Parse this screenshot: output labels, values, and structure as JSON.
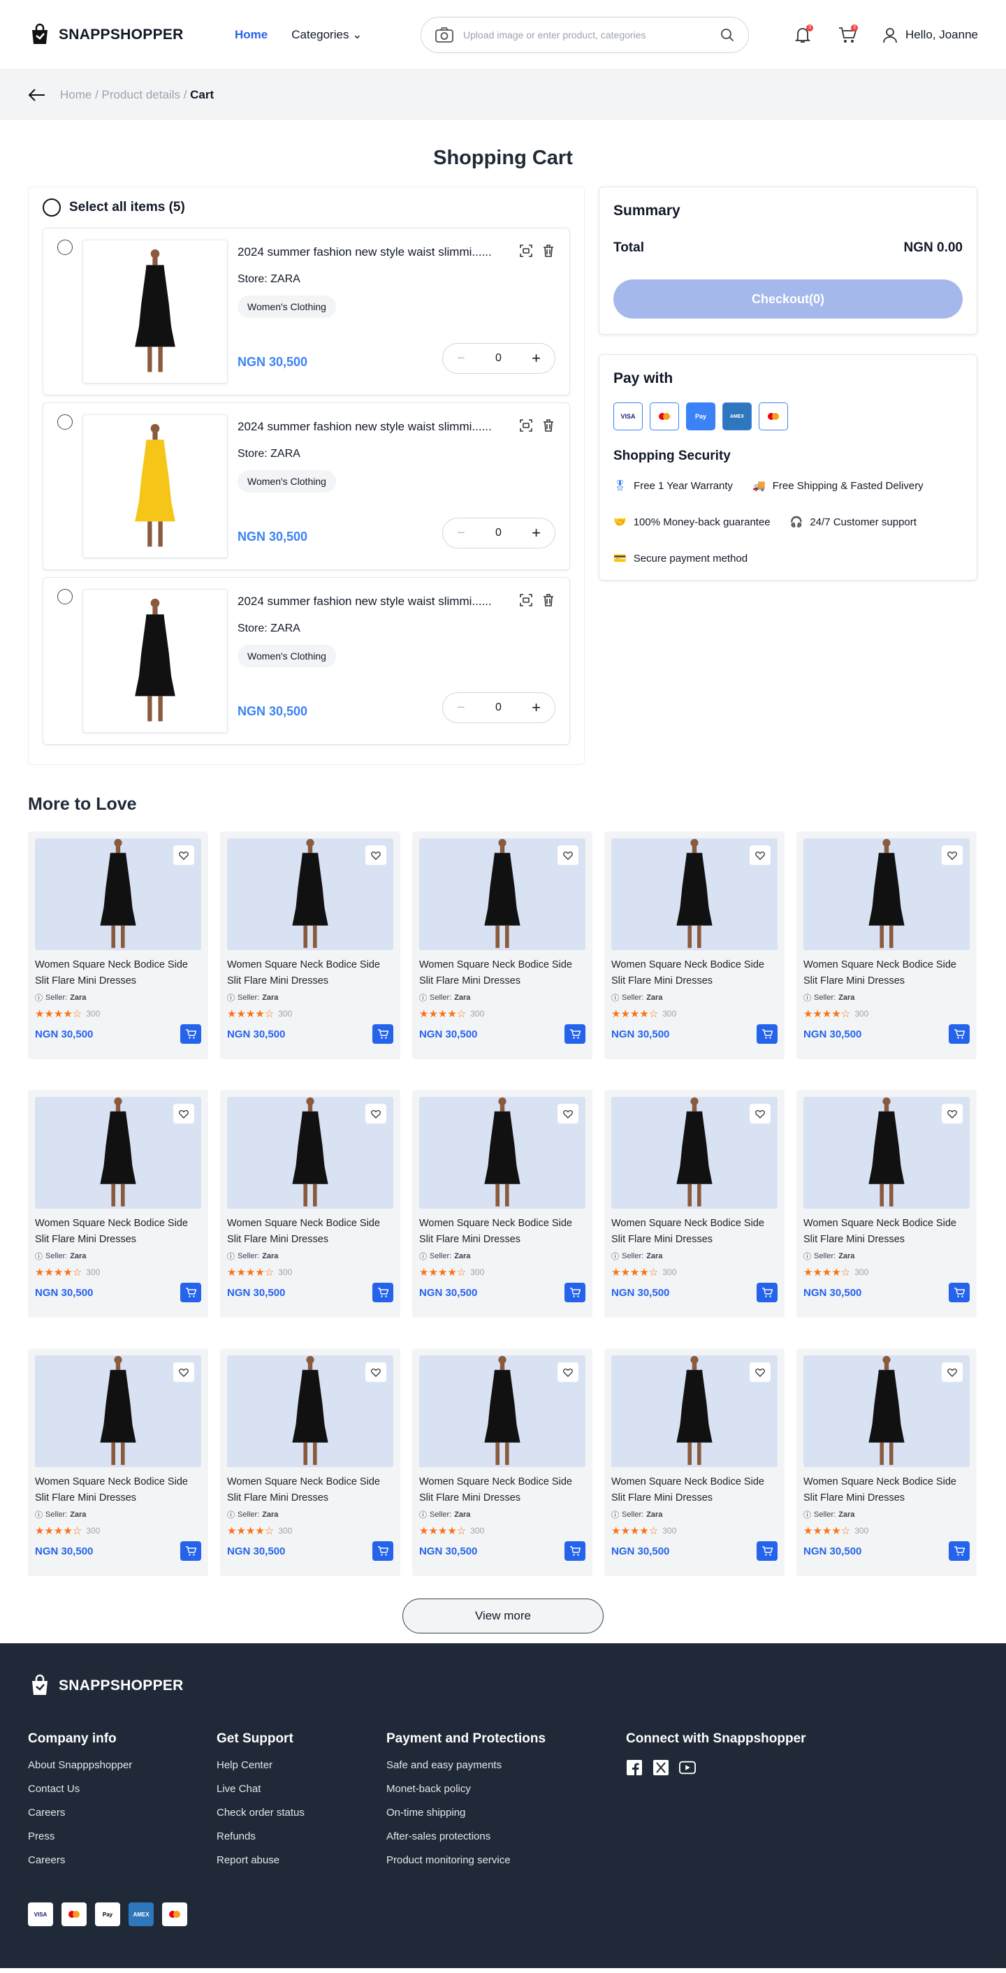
{
  "header": {
    "brand": "SNAPPSHOPPER",
    "nav_home": "Home",
    "nav_categories": "Categories",
    "search_placeholder": "Upload image or enter product, categories",
    "greeting": "Hello, Joanne",
    "notif_count": "3",
    "cart_count": "3"
  },
  "breadcrumb": {
    "home": "Home",
    "product": "Product details",
    "current": "Cart"
  },
  "page_title": "Shopping Cart",
  "cart": {
    "select_all": "Select all items (5)",
    "items": [
      {
        "title": "2024 summer fashion new style waist slimmi......",
        "store": "Store: ZARA",
        "tag": "Women's Clothing",
        "price": "NGN 30,500",
        "qty": "0",
        "color": "black"
      },
      {
        "title": "2024 summer fashion new style waist slimmi......",
        "store": "Store: ZARA",
        "tag": "Women's Clothing",
        "price": "NGN 30,500",
        "qty": "0",
        "color": "yellow"
      },
      {
        "title": "2024 summer fashion new style waist slimmi......",
        "store": "Store: ZARA",
        "tag": "Women's Clothing",
        "price": "NGN 30,500",
        "qty": "0",
        "color": "black"
      }
    ]
  },
  "summary": {
    "title": "Summary",
    "total_label": "Total",
    "total_value": "NGN 0.00",
    "checkout": "Checkout(0)"
  },
  "pay": {
    "title": "Pay with",
    "security_title": "Shopping Security",
    "methods": [
      "VISA",
      "MC",
      "Pay",
      "AMEX",
      "MC"
    ],
    "features": [
      "Free 1 Year Warranty",
      "Free Shipping & Fasted Delivery",
      "100% Money-back guarantee",
      "24/7 Customer support",
      "Secure payment method"
    ]
  },
  "more": {
    "title": "More to Love",
    "product": {
      "title": "Women Square Neck Bodice Side Slit Flare Mini Dresses",
      "seller_label": "Seller:",
      "seller": "Zara",
      "rating": 4,
      "reviews": "300",
      "price": "NGN 30,500"
    },
    "count": 15,
    "view_more": "View more"
  },
  "footer": {
    "brand": "SNAPPSHOPPER",
    "cols": [
      {
        "title": "Company info",
        "links": [
          "About Snapppshopper",
          "Contact Us",
          "Careers",
          "Press",
          "Careers"
        ]
      },
      {
        "title": "Get Support",
        "links": [
          "Help Center",
          "Live Chat",
          "Check order status",
          "Refunds",
          "Report abuse"
        ]
      },
      {
        "title": "Payment and Protections",
        "links": [
          "Safe and easy payments",
          "Monet-back policy",
          "On-time shipping",
          "After-sales protections",
          "Product monitoring service"
        ]
      },
      {
        "title": "Connect with Snappshopper",
        "links": []
      }
    ]
  }
}
